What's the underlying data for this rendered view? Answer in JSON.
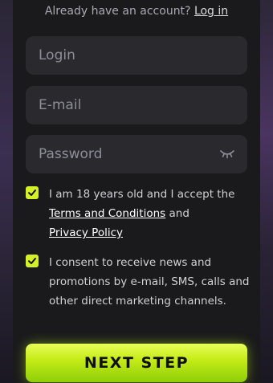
{
  "header": {
    "prompt_text": "Already have an account?",
    "login_link": "Log in"
  },
  "form": {
    "login_placeholder": "Login",
    "email_placeholder": "E-mail",
    "password_placeholder": "Password",
    "password_toggle_icon": "eye-closed-icon"
  },
  "consent": {
    "age_text": "I am 18 years old and I accept the",
    "terms_link": "Terms and Conditions",
    "and_text": "and",
    "privacy_link": "Privacy Policy",
    "age_checked": true,
    "marketing_text": "I consent to receive news and promotions by e-mail, SMS, calls and other direct marketing channels.",
    "marketing_checked": true
  },
  "cta": {
    "label": "NEXT STEP"
  },
  "colors": {
    "accent": "#d4f027",
    "panel": "#1a1a1c",
    "field": "#2a2a2e"
  }
}
